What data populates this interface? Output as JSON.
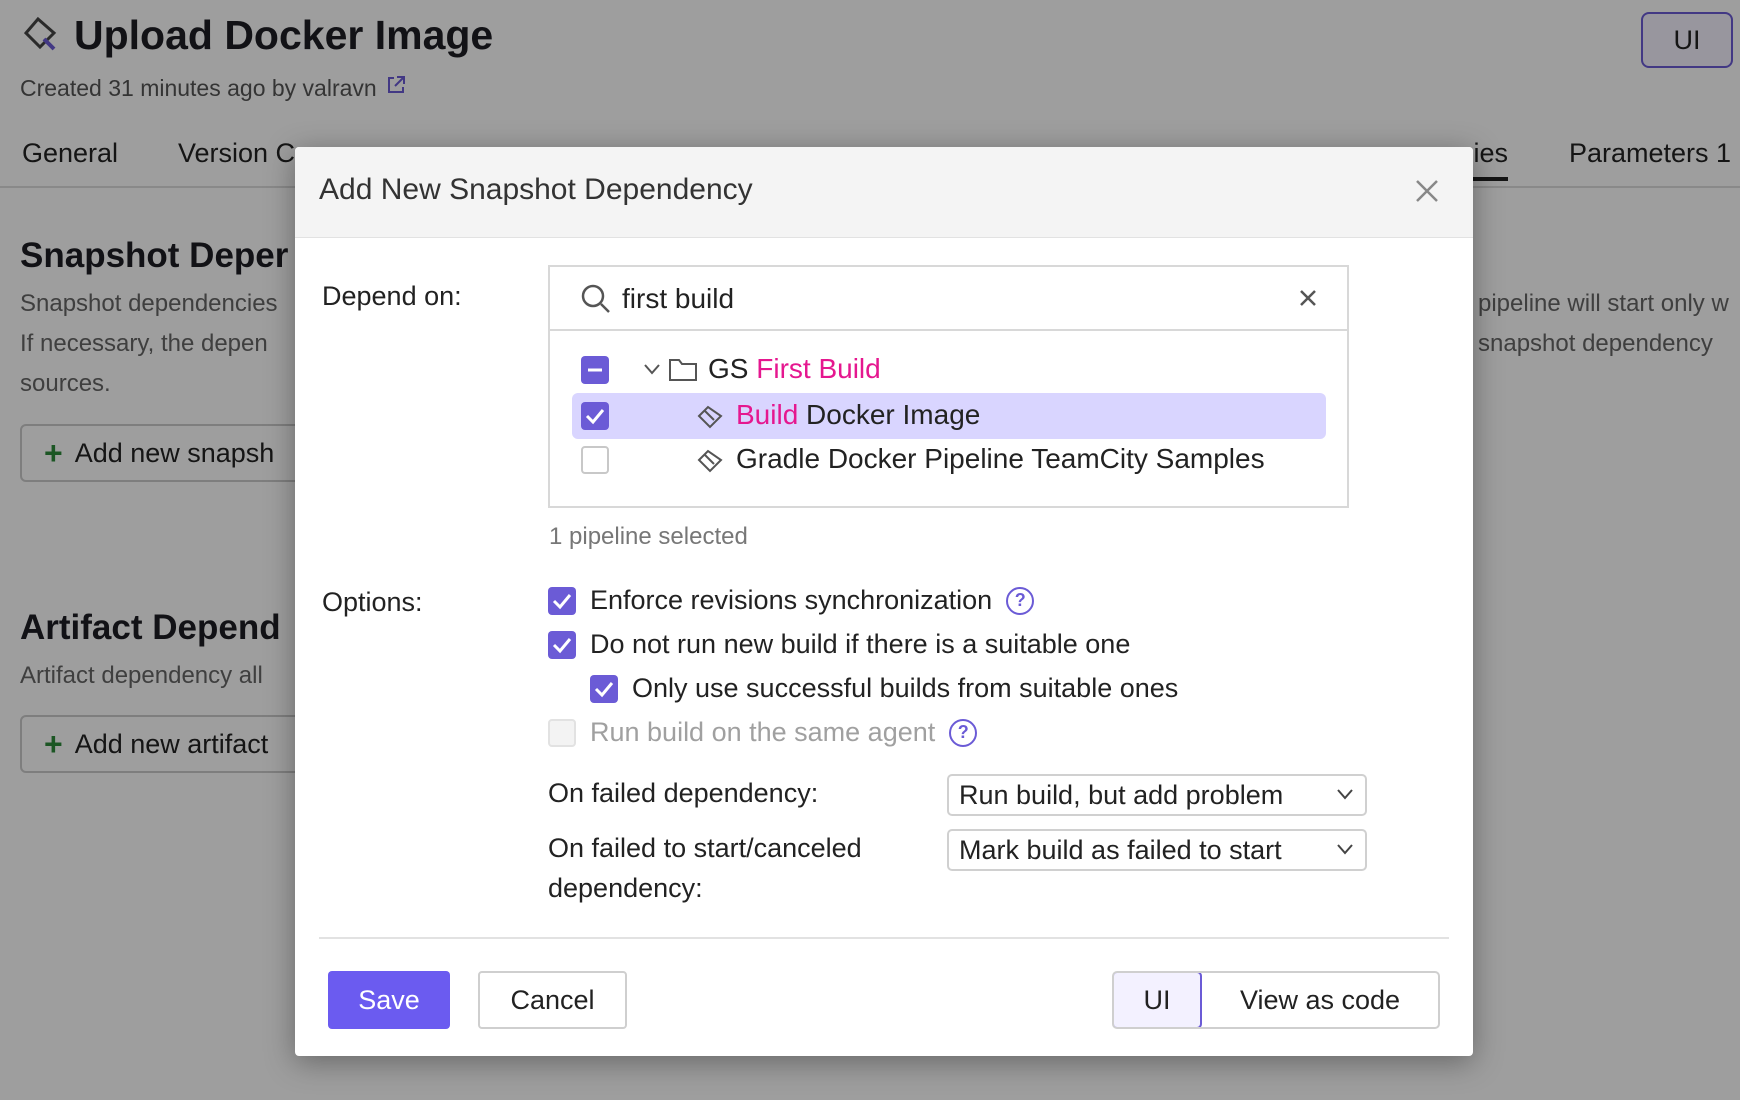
{
  "page": {
    "title": "Upload Docker Image",
    "subtitle": "Created 31 minutes ago by valravn",
    "ui_toggle": "UI",
    "tabs": {
      "general": "General",
      "version": "Version C",
      "dependencies": "cies",
      "parameters": "Parameters 1"
    },
    "snapshot": {
      "title": "Snapshot Deper",
      "line1": "Snapshot dependencies",
      "line2": "If necessary, the depen",
      "line3": "sources.",
      "button": "Add new snapsh"
    },
    "artifact": {
      "title": "Artifact Depend",
      "line1": "Artifact dependency all",
      "button": "Add new artifact"
    },
    "right_line1": "pipeline will start only w",
    "right_line2": "snapshot dependency"
  },
  "dialog": {
    "title": "Add New Snapshot Dependency",
    "depend_on_label": "Depend on:",
    "search": {
      "value": "first build",
      "placeholder": ""
    },
    "tree": {
      "project_prefix": "GS",
      "project_match": "First Build",
      "item1_match": "Build",
      "item1_rest": "Docker Image",
      "item2": "Gradle Docker Pipeline TeamCity Samples"
    },
    "selected_hint": "1 pipeline selected",
    "options_label": "Options:",
    "options": {
      "enforce": "Enforce revisions synchronization",
      "no_new_build": "Do not run new build if there is a suitable one",
      "only_successful": "Only use successful builds from suitable ones",
      "same_agent": "Run build on the same agent"
    },
    "on_failed_label": "On failed dependency:",
    "on_failed_value": "Run build, but add problem",
    "on_failed_start_label_1": "On failed to start/canceled",
    "on_failed_start_label_2": "dependency:",
    "on_failed_start_value": "Mark build as failed to start",
    "save": "Save",
    "cancel": "Cancel",
    "ui": "UI",
    "view_code": "View as code"
  },
  "colors": {
    "accent": "#6b5bd6",
    "highlight": "#e5178f",
    "selected_row": "#d9d5ff"
  }
}
